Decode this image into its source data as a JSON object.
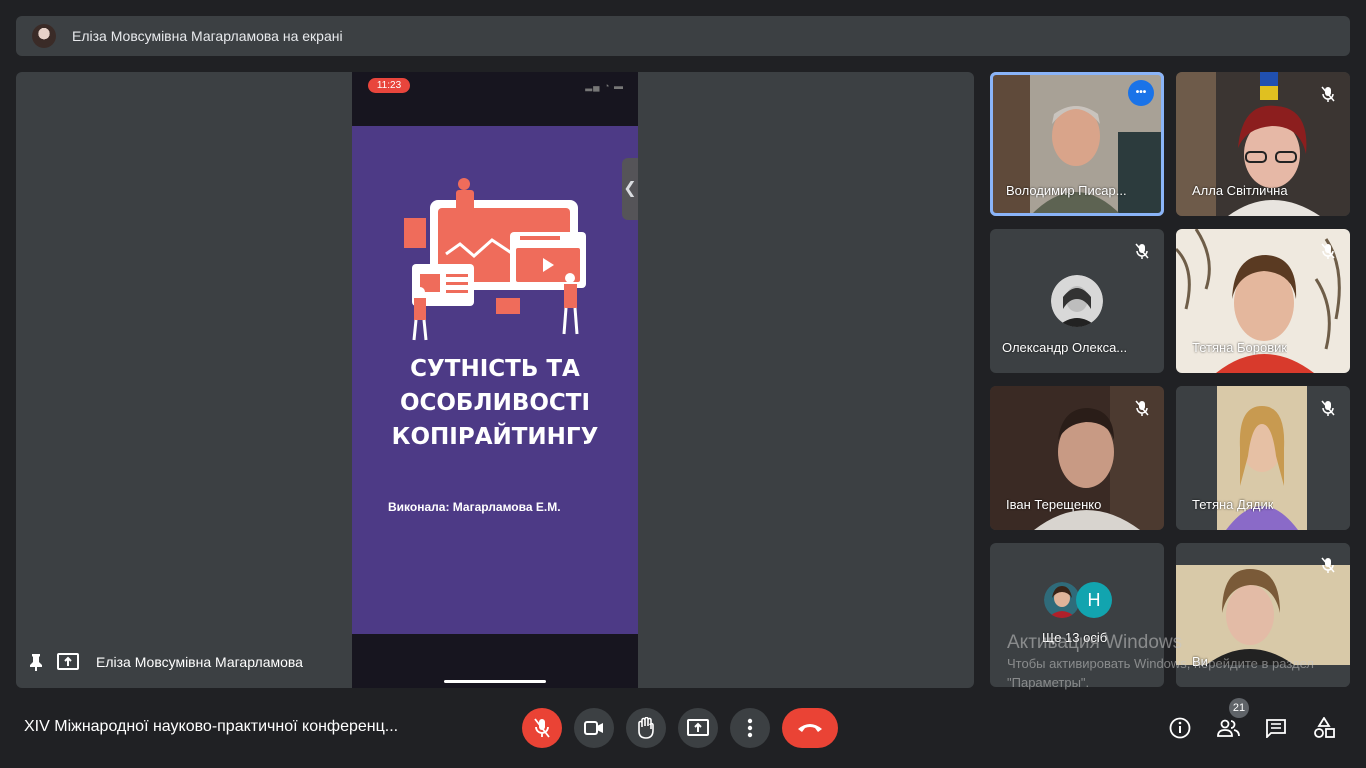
{
  "presenting_banner": {
    "text": "Еліза Мовсумівна Магарламова на екрані"
  },
  "stage": {
    "presenter_name": "Еліза Мовсумівна Магарламова",
    "phone": {
      "time": "11:23",
      "slide_title": "СУТНІСТЬ ТА\nОСОБЛИВОСТІ\nКОПІРАЙТИНГУ",
      "slide_author": "Виконала: Магарламова Е.М.",
      "bg_color": "#4d3a86"
    },
    "collapse_glyph": "❮"
  },
  "participants": [
    {
      "name": "Володимир Писар...",
      "speaking": true
    },
    {
      "name": "Алла Світлична",
      "muted": true
    },
    {
      "name": "Олександр Олекса...",
      "muted": true
    },
    {
      "name": "Тетяна Боровик",
      "muted": true
    },
    {
      "name": "Іван Терещенко",
      "muted": true
    },
    {
      "name": "Тетяна Дядик",
      "muted": true
    },
    {
      "name": "Ще 13 осіб",
      "avatar_letter": "Н"
    },
    {
      "name": "Ви",
      "muted": true
    }
  ],
  "watermark": {
    "heading": "Активация Windows",
    "text": "Чтобы активировать Windows, перейдите в раздел \"Параметры\"."
  },
  "bottom_bar": {
    "meeting_title": "XIV Міжнародної науково-практичної конференц...",
    "people_count": "21",
    "more_glyph": "•••"
  },
  "colors": {
    "accent": "#8ab4f8",
    "danger": "#ea4335",
    "surface": "#3c4043",
    "background": "#202124"
  }
}
